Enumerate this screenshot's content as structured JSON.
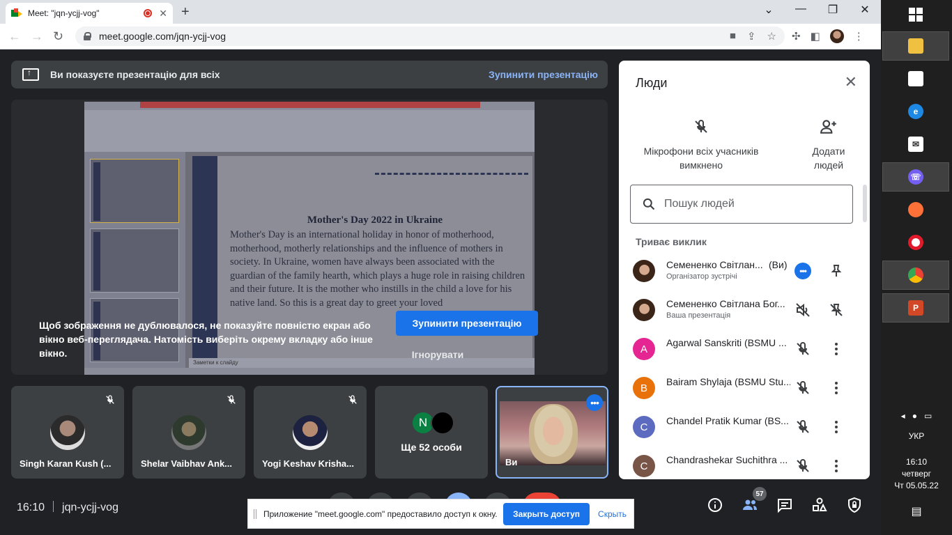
{
  "browser": {
    "tab_title": "Meet: \"jqn-ycjj-vog\"",
    "url": "meet.google.com/jqn-ycjj-vog",
    "new_tab": "+",
    "close": "✕",
    "minimize": "—",
    "restore": "❐",
    "dropdown": "⌄"
  },
  "present_bar": {
    "text": "Ви показуєте презентацію для всіх",
    "stop": "Зупинити презентацію"
  },
  "slide": {
    "title": "Mother's Day 2022 in Ukraine",
    "body": "Mother's Day is an international holiday in honor of motherhood, motherhood, motherly relationships and the influence of mothers in society. In Ukraine, women have always been associated with the guardian of the family hearth, which plays a huge role in raising children and their future. It is the mother who instills in the child a love for his native land. So this is a great day to greet your loved",
    "notes": "Заметки к слайду"
  },
  "overlay": {
    "warning": "Щоб зображення не дублювалося, не показуйте повністю екран або вікно веб-переглядача. Натомість виберіть окрему вкладку або інше вікно.",
    "stop_button": "Зупинити презентацію",
    "ignore_button": "Ігнорувати"
  },
  "tiles": [
    {
      "name": "Singh Karan Kush (..."
    },
    {
      "name": "Shelar Vaibhav Ank..."
    },
    {
      "name": "Yogi Keshav Krisha..."
    },
    {
      "name": "Ще 52 особи",
      "badge": "N"
    },
    {
      "name": "Ви"
    }
  ],
  "bottom": {
    "time": "16:10",
    "meeting_code": "jqn-ycjj-vog",
    "participants_count": "57"
  },
  "notification": {
    "text": "Приложение \"meet.google.com\" предоставило доступ к окну.",
    "close_access": "Закрыть доступ",
    "hide": "Скрыть"
  },
  "people_panel": {
    "title": "Люди",
    "mute_all": "Мікрофони всіх учасників вимкнено",
    "add_people": "Додати людей",
    "search_placeholder": "Пошук людей",
    "section": "Триває виклик",
    "participants": [
      {
        "name": "Семененко Світлан...",
        "you": "(Ви)",
        "sub": "Організатор зустрічі"
      },
      {
        "name": "Семененко Світлана Бог...",
        "sub": "Ваша презентація"
      },
      {
        "initial": "A",
        "color": "#e52592",
        "name": "Agarwal Sanskriti (BSMU ..."
      },
      {
        "initial": "B",
        "color": "#e8710a",
        "name": "Bairam Shylaja (BSMU Stu..."
      },
      {
        "initial": "C",
        "color": "#5c6bc0",
        "name": "Chandel Pratik Kumar (BS..."
      },
      {
        "initial": "C",
        "color": "#795548",
        "name": "Chandrashekar Suchithra ..."
      }
    ]
  },
  "taskbar": {
    "lang": "УКР",
    "time": "16:10",
    "day": "четверг",
    "date": "Чт 05.05.22"
  }
}
